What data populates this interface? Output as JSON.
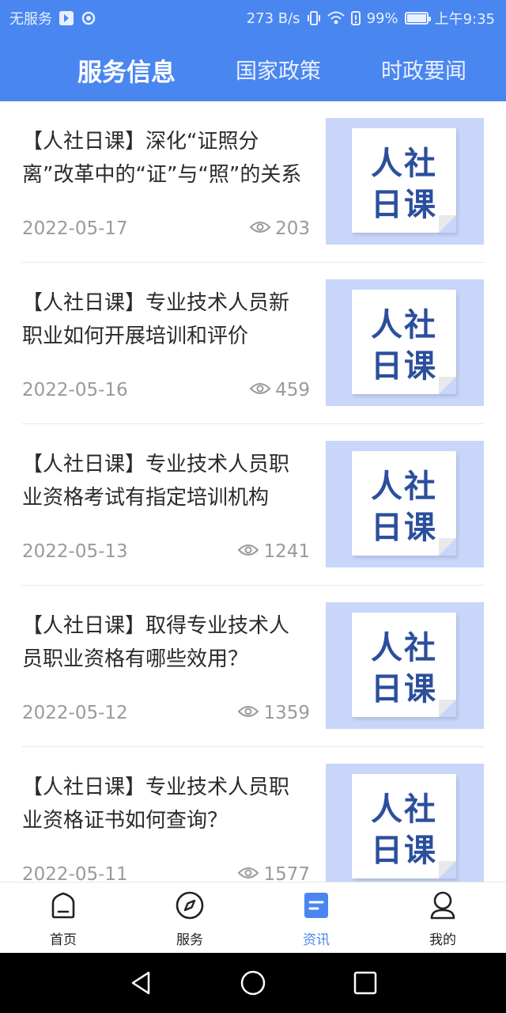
{
  "status_bar": {
    "carrier": "无服务",
    "net_speed": "273 B/s",
    "battery": "99%",
    "battery_level": 0.99,
    "time": "上午9:35"
  },
  "tabs": [
    {
      "label": "服务信息",
      "active": true
    },
    {
      "label": "国家政策",
      "active": false
    },
    {
      "label": "时政要闻",
      "active": false
    }
  ],
  "thumbnail_text": {
    "line1": "人社",
    "line2": "日课"
  },
  "articles": [
    {
      "title": "【人社日课】深化“证照分离”改革中的“证”与“照”的关系",
      "date": "2022-05-17",
      "views": "203"
    },
    {
      "title": "【人社日课】专业技术人员新职业如何开展培训和评价",
      "date": "2022-05-16",
      "views": "459"
    },
    {
      "title": "【人社日课】专业技术人员职业资格考试有指定培训机构",
      "date": "2022-05-13",
      "views": "1241"
    },
    {
      "title": "【人社日课】取得专业技术人员职业资格有哪些效用？",
      "date": "2022-05-12",
      "views": "1359"
    },
    {
      "title": "【人社日课】专业技术人员职业资格证书如何查询？",
      "date": "2022-05-11",
      "views": "1577"
    }
  ],
  "bottom_nav": [
    {
      "label": "首页",
      "icon": "home-icon",
      "active": false
    },
    {
      "label": "服务",
      "icon": "compass-icon",
      "active": false
    },
    {
      "label": "资讯",
      "icon": "news-icon",
      "active": true
    },
    {
      "label": "我的",
      "icon": "user-icon",
      "active": false
    }
  ],
  "colors": {
    "brand": "#4a86f0",
    "thumb_bg": "#c7d6f9",
    "thumb_text": "#2b4f9c"
  }
}
